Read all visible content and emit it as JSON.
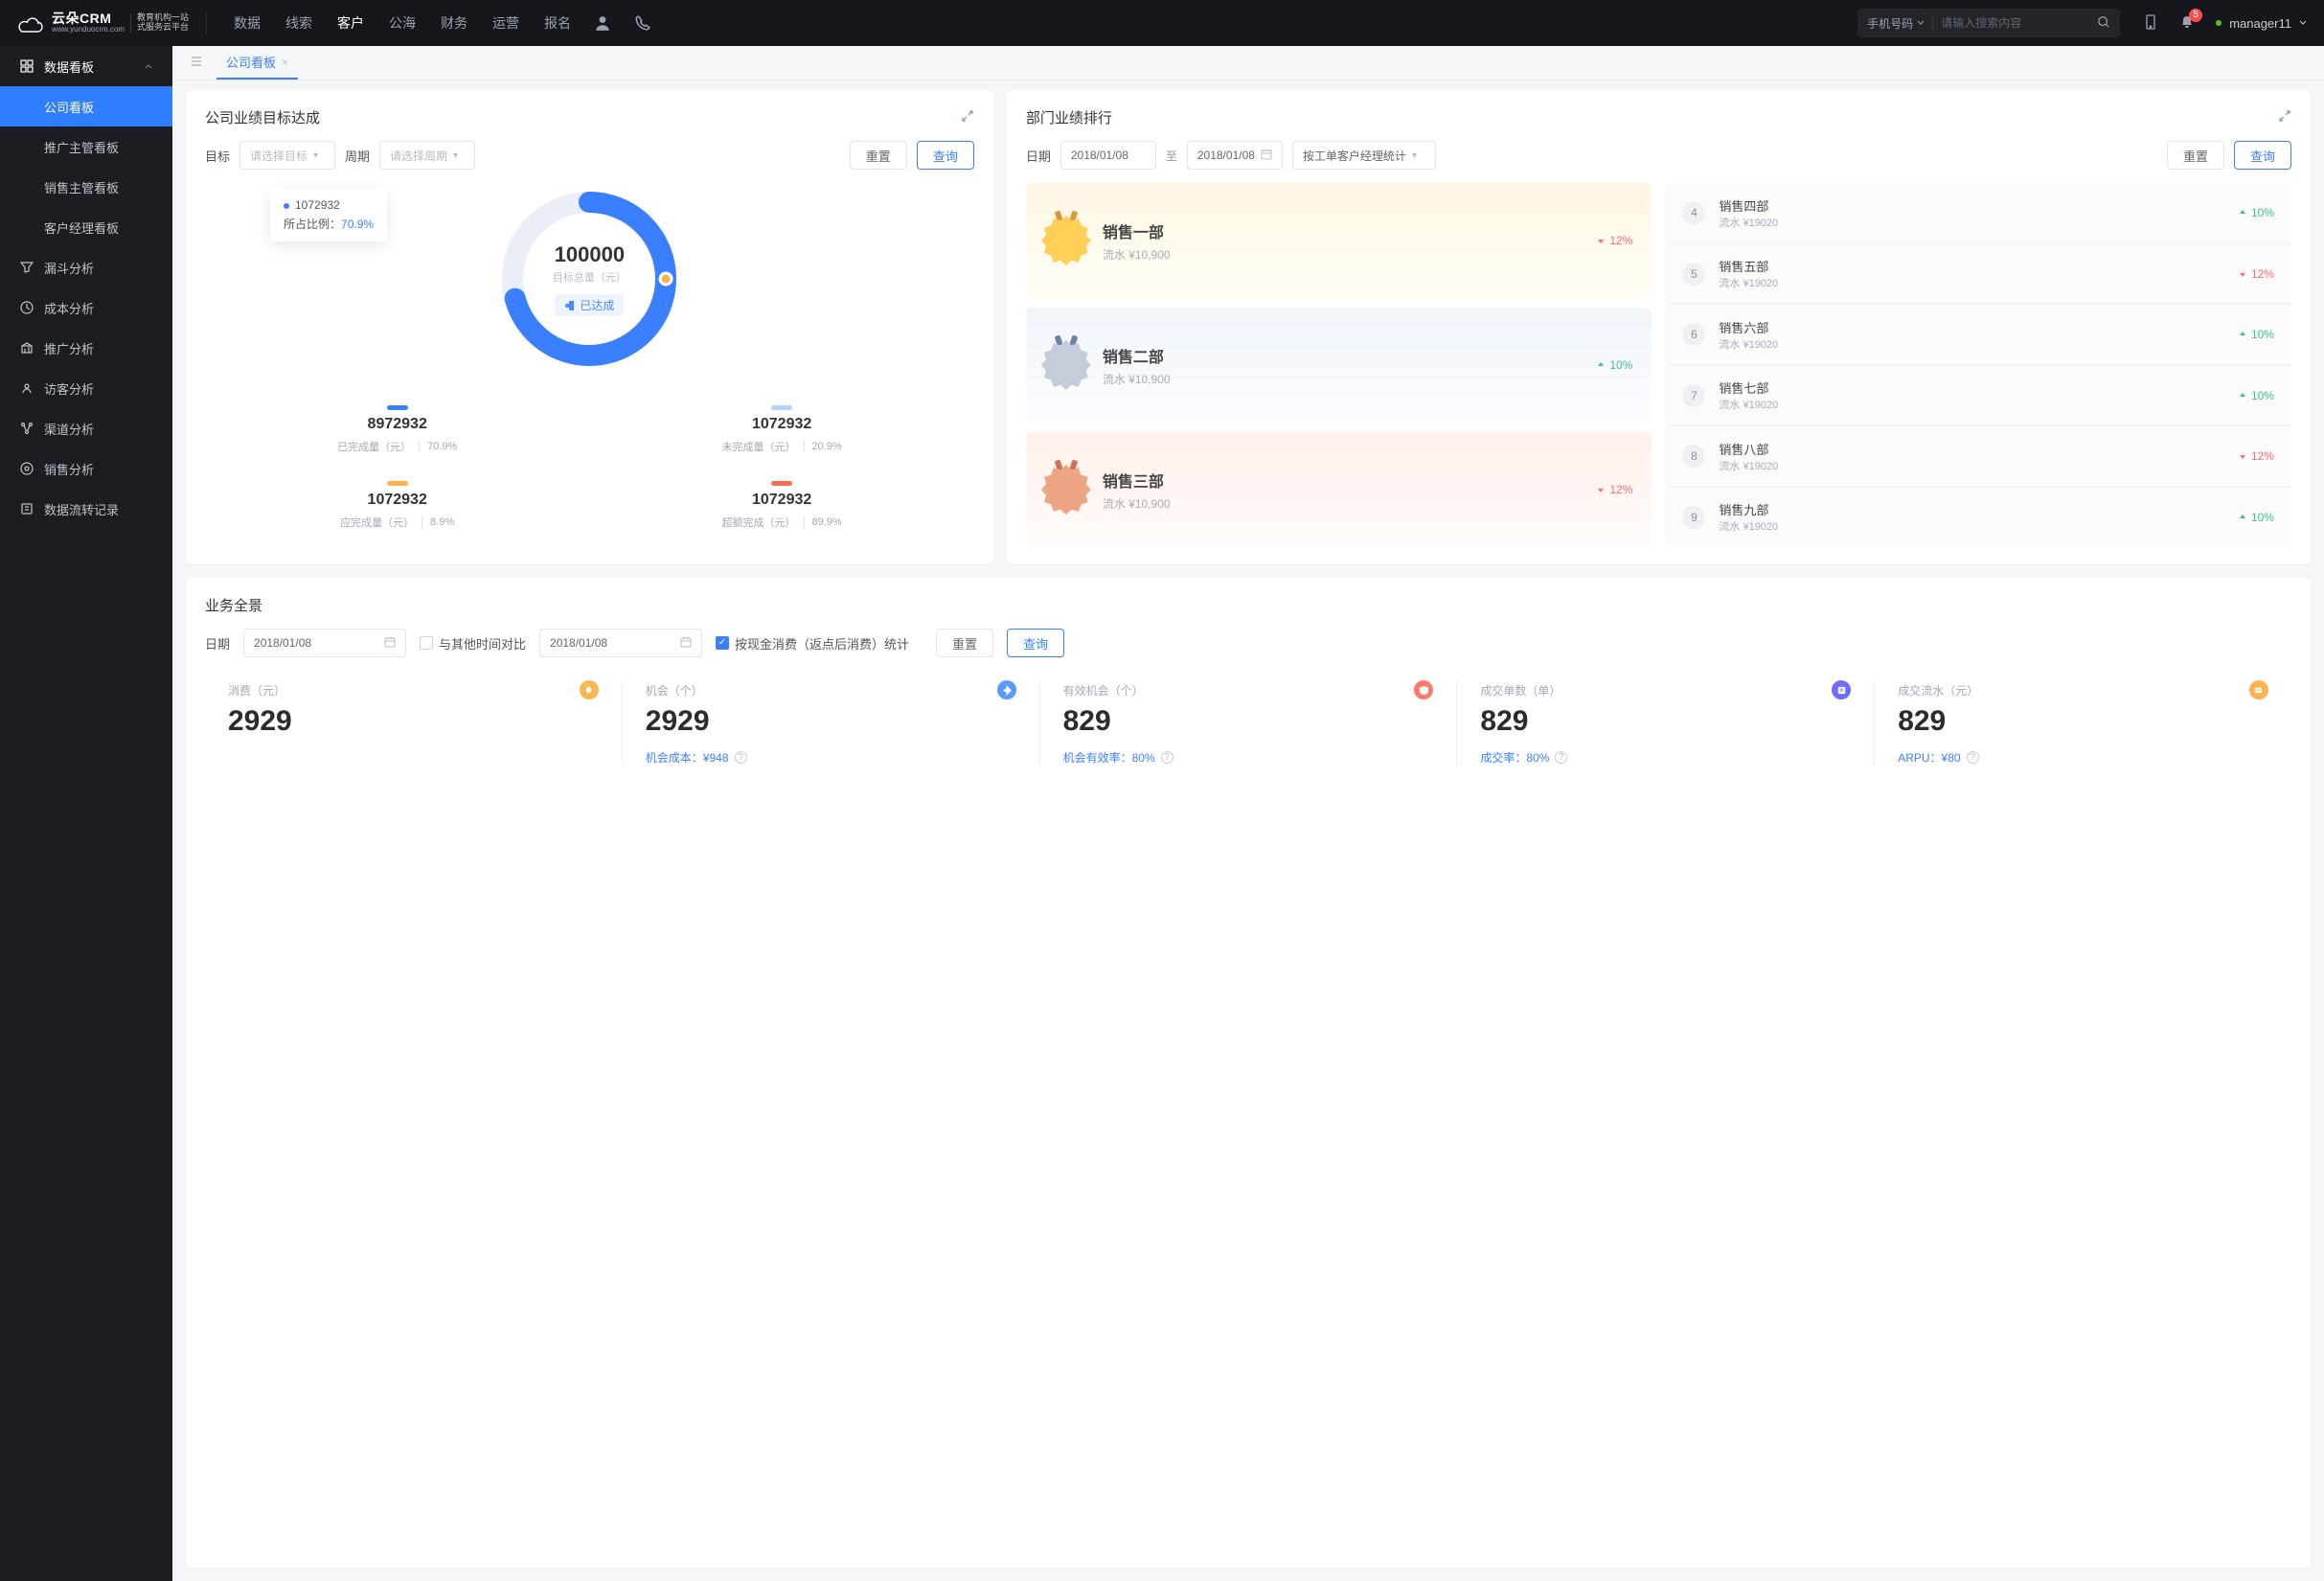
{
  "header": {
    "brand": "云朵CRM",
    "brand_sub1": "教育机构一站",
    "brand_sub2": "式服务云平台",
    "brand_url": "www.yunduocrm.com",
    "nav": [
      "数据",
      "线索",
      "客户",
      "公海",
      "财务",
      "运营",
      "报名"
    ],
    "active_nav_index": 2,
    "search_type": "手机号码",
    "search_placeholder": "请输入搜索内容",
    "user": "manager11",
    "badge": "5"
  },
  "chart_data": {
    "type": "pie",
    "title": "公司业绩目标达成",
    "total_label": "目标总量（元）",
    "total": 100000,
    "achieved_label": "已达成",
    "tooltip_value": "1072932",
    "tooltip_ratio_label": "所占比例：",
    "tooltip_ratio": "70.9%",
    "series": [
      {
        "name": "已完成量（元）",
        "value": 8972932,
        "pct": "70.9%",
        "color": "#3a7fff"
      },
      {
        "name": "未完成量（元）",
        "value": 1072932,
        "pct": "20.9%",
        "color": "#b4d3ff"
      },
      {
        "name": "应完成量（元）",
        "value": 1072932,
        "pct": "8.9%",
        "color": "#ffb24d"
      },
      {
        "name": "超额完成（元）",
        "value": 1072932,
        "pct": "89.9%",
        "color": "#ff6c4d"
      }
    ]
  },
  "sidebar": {
    "header": "数据看板",
    "items": [
      {
        "label": "公司看板",
        "active": true
      },
      {
        "label": "推广主管看板"
      },
      {
        "label": "销售主管看板"
      },
      {
        "label": "客户经理看板"
      }
    ],
    "links": [
      {
        "icon": "funnel",
        "label": "漏斗分析"
      },
      {
        "icon": "cost",
        "label": "成本分析"
      },
      {
        "icon": "promo",
        "label": "推广分析"
      },
      {
        "icon": "visitor",
        "label": "访客分析"
      },
      {
        "icon": "channel",
        "label": "渠道分析"
      },
      {
        "icon": "sales",
        "label": "销售分析"
      },
      {
        "icon": "flow",
        "label": "数据流转记录"
      }
    ]
  },
  "tabs": {
    "active": "公司看板"
  },
  "perf": {
    "title": "公司业绩目标达成",
    "goal_label": "目标",
    "goal_placeholder": "请选择目标",
    "period_label": "周期",
    "period_placeholder": "请选择周期",
    "reset": "重置",
    "query": "查询"
  },
  "rank": {
    "title": "部门业绩排行",
    "date_label": "日期",
    "date_start": "2018/01/08",
    "date_sep": "至",
    "date_end": "2018/01/08",
    "mode_placeholder": "按工单客户经理统计",
    "reset": "重置",
    "query": "查询",
    "top3": [
      {
        "rank": "1",
        "name": "销售一部",
        "value": "流水 ¥10,900",
        "delta": "12%",
        "dir": "down"
      },
      {
        "rank": "2",
        "name": "销售二部",
        "value": "流水 ¥10,900",
        "delta": "10%",
        "dir": "up"
      },
      {
        "rank": "3",
        "name": "销售三部",
        "value": "流水 ¥10,900",
        "delta": "12%",
        "dir": "down"
      }
    ],
    "rest": [
      {
        "rank": "4",
        "name": "销售四部",
        "value": "流水 ¥19020",
        "delta": "10%",
        "dir": "up"
      },
      {
        "rank": "5",
        "name": "销售五部",
        "value": "流水 ¥19020",
        "delta": "12%",
        "dir": "down"
      },
      {
        "rank": "6",
        "name": "销售六部",
        "value": "流水 ¥19020",
        "delta": "10%",
        "dir": "up"
      },
      {
        "rank": "7",
        "name": "销售七部",
        "value": "流水 ¥19020",
        "delta": "10%",
        "dir": "up"
      },
      {
        "rank": "8",
        "name": "销售八部",
        "value": "流水 ¥19020",
        "delta": "12%",
        "dir": "down"
      },
      {
        "rank": "9",
        "name": "销售九部",
        "value": "流水 ¥19020",
        "delta": "10%",
        "dir": "up"
      }
    ]
  },
  "overview": {
    "title": "业务全景",
    "date_label": "日期",
    "date1": "2018/01/08",
    "compare_label": "与其他时间对比",
    "date2": "2018/01/08",
    "checkbox_label": "按现金消费（返点后消费）统计",
    "reset": "重置",
    "query": "查询",
    "kpis": [
      {
        "label": "消费（元）",
        "value": "2929",
        "icon": "orange",
        "sub_label": "",
        "sub_value": ""
      },
      {
        "label": "机会（个）",
        "value": "2929",
        "icon": "blue",
        "sub_label": "机会成本：",
        "sub_value": "¥948"
      },
      {
        "label": "有效机会（个）",
        "value": "829",
        "icon": "red",
        "sub_label": "机会有效率：",
        "sub_value": "80%"
      },
      {
        "label": "成交单数（单）",
        "value": "829",
        "icon": "indigo",
        "sub_label": "成交率：",
        "sub_value": "80%"
      },
      {
        "label": "成交流水（元）",
        "value": "829",
        "icon": "amber",
        "sub_label": "ARPU：",
        "sub_value": "¥80"
      }
    ]
  }
}
